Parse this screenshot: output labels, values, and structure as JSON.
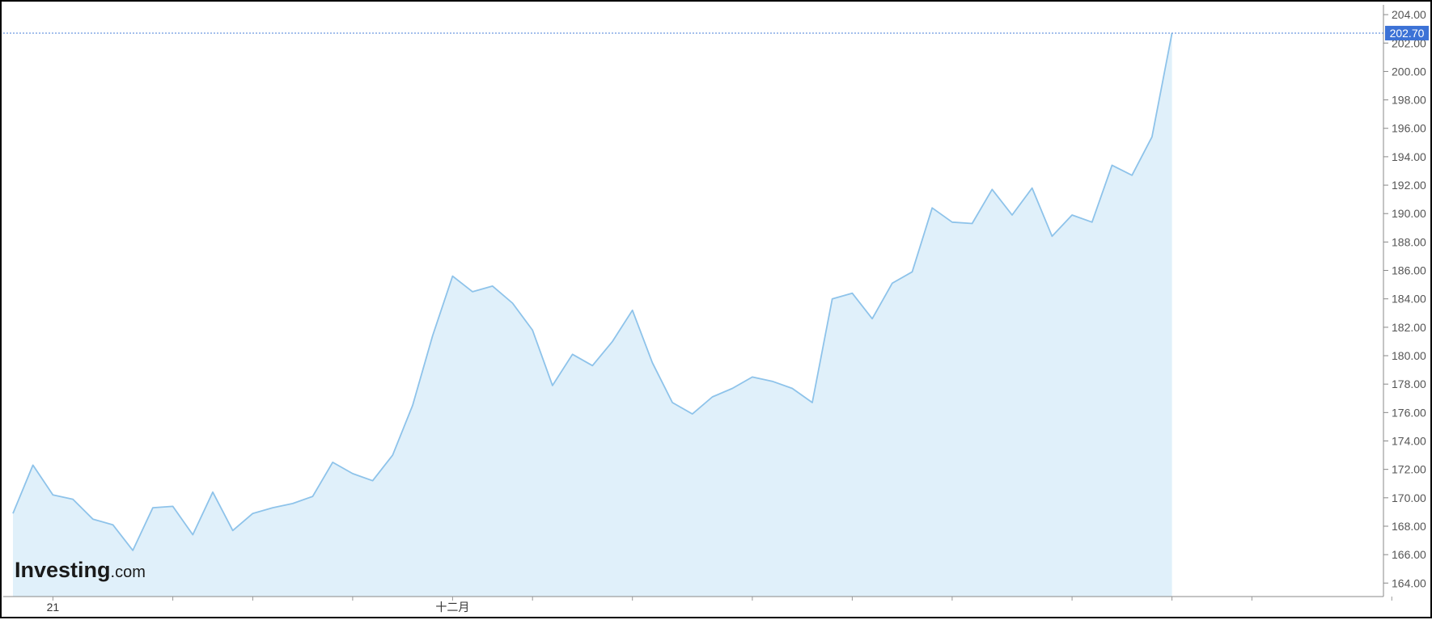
{
  "logo": {
    "brand": "Investing",
    "suffix": ".com"
  },
  "chart_data": {
    "type": "area",
    "y_axis_side": "right",
    "ylim": [
      163.0,
      205.0
    ],
    "yticks": [
      "164.00",
      "166.00",
      "168.00",
      "170.00",
      "172.00",
      "174.00",
      "176.00",
      "178.00",
      "180.00",
      "182.00",
      "184.00",
      "186.00",
      "188.00",
      "190.00",
      "192.00",
      "194.00",
      "196.00",
      "198.00",
      "200.00",
      "202.00",
      "204.00"
    ],
    "x_labels": [
      {
        "index": 2,
        "text": "21"
      },
      {
        "index": 22,
        "text": "十二月"
      }
    ],
    "x_minor_ticks": [
      8,
      12,
      17,
      26,
      31,
      37,
      42,
      47,
      53,
      58,
      62,
      69,
      73
    ],
    "x_count": 74,
    "current_price": "202.70",
    "colors": {
      "line": "#8ec3ea",
      "fill": "#e0f0fa",
      "price_line": "#4a7fd8",
      "price_badge": "#3c72d6"
    },
    "grid": false,
    "series": [
      {
        "values": [
          168.9,
          172.3,
          170.2,
          169.9,
          168.5,
          168.1,
          166.3,
          169.3,
          169.4,
          167.4,
          170.4,
          167.7,
          168.9,
          169.3,
          169.6,
          170.1,
          172.5,
          171.7,
          171.2,
          173.0,
          176.5,
          181.4,
          185.6,
          184.5,
          184.9,
          183.7,
          181.8,
          177.9,
          180.1,
          179.3,
          181.0,
          183.2,
          179.5,
          176.7,
          175.9,
          177.1,
          177.7,
          178.5,
          178.2,
          177.7,
          176.7,
          184.0,
          184.4,
          182.6,
          185.1,
          185.9,
          190.4,
          189.4,
          189.3,
          191.7,
          189.9,
          191.8,
          188.4,
          189.9,
          189.4,
          193.4,
          192.7,
          195.4,
          202.7
        ]
      }
    ]
  }
}
